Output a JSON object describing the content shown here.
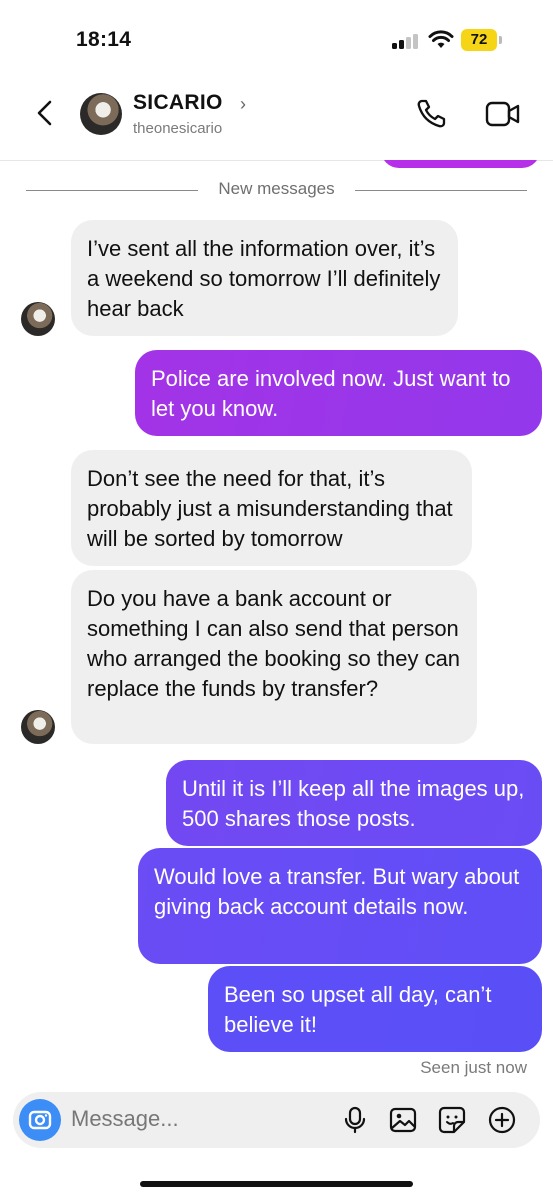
{
  "status": {
    "time": "18:14",
    "battery": "72"
  },
  "header": {
    "name": "SICARIO",
    "handle": "theonesicario"
  },
  "chat": {
    "divider_label": "New messages",
    "messages": [
      {
        "from": "them",
        "text": "I’ve sent all the information over, it’s a weekend so tomorrow I’ll definitely hear back"
      },
      {
        "from": "me",
        "text": "Police are involved now. Just want to let you know."
      },
      {
        "from": "them",
        "text": "Don’t see the need for that, it’s probably just a misunderstanding that will be sorted by tomorrow"
      },
      {
        "from": "them",
        "text": "Do you have a bank account or something I can also send that person who arranged the booking so they can replace the funds by transfer?"
      },
      {
        "from": "me",
        "text": "Until it is I’ll keep all the images up, 500 shares those posts."
      },
      {
        "from": "me",
        "text": "Would love a transfer. But wary about giving back account details now."
      },
      {
        "from": "me",
        "text": "Been so upset all day, can’t believe it!"
      }
    ],
    "seen_label": "Seen just now"
  },
  "composer": {
    "placeholder": "Message...",
    "icons": [
      "camera-icon",
      "microphone-icon",
      "image-icon",
      "sticker-icon",
      "plus-icon"
    ]
  },
  "colors": {
    "incoming_bubble": "#efeff0",
    "outgoing_gradient": [
      "#a333e6",
      "#8d3fef",
      "#6c4df5",
      "#5a4ff7"
    ],
    "battery": "#f5d516",
    "camera_button": "#3c8df6"
  }
}
